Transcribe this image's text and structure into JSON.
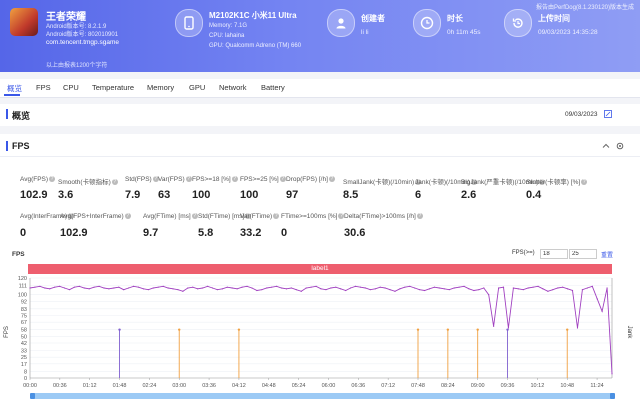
{
  "header": {
    "watermark": "报告由PerfDog(8.1.230120)版本生成",
    "app": {
      "name": "王者荣耀",
      "android_version": "Android版本号: 8.2.1.9",
      "android_build": "Android版本号: 802010901",
      "package": "com.tencent.tmgp.sgame",
      "subtitle": "以上由报表1200个字符"
    },
    "device": {
      "name": "M2102K1C 小米11 Ultra",
      "memory": "Memory: 7.1G",
      "cpu": "CPU: lahaina",
      "gpu": "GPU: Qualcomm Adreno (TM) 660"
    },
    "creator": {
      "title": "创建者",
      "value": "li li"
    },
    "duration": {
      "title": "时长",
      "value": "0h 11m 45s"
    },
    "upload": {
      "title": "上传时间",
      "value": "09/03/2023 14:35:28"
    }
  },
  "tabs": [
    "概览",
    "FPS",
    "CPU",
    "Temperature",
    "Memory",
    "GPU",
    "Network",
    "Battery"
  ],
  "overview": {
    "title": "概览",
    "date": "09/03/2023"
  },
  "fps_panel": {
    "title": "FPS",
    "stats_row1": [
      {
        "label": "Avg(FPS)",
        "value": "102.9"
      },
      {
        "label": "Smooth(卡顿指标)",
        "value": "3.6"
      },
      {
        "label": "Std(FPS)",
        "value": "7.9"
      },
      {
        "label": "Var(FPS)",
        "value": "63"
      },
      {
        "label": "FPS>=18 [%]",
        "value": "100"
      },
      {
        "label": "FPS>=25 [%]",
        "value": "100"
      },
      {
        "label": "Drop(FPS) [/h]",
        "value": "97"
      },
      {
        "label": "SmallJank(卡顿)(/10min)",
        "value": "8.5"
      },
      {
        "label": "Jank(卡顿)(/10min)",
        "value": "6"
      },
      {
        "label": "BigJank(严重卡顿)(/10min)",
        "value": "2.6"
      },
      {
        "label": "Stutter(卡顿率) [%]",
        "value": "0.4"
      }
    ],
    "stats_row2": [
      {
        "label": "Avg(InterFrame)",
        "value": "0"
      },
      {
        "label": "Avg(FPS+InterFrame)",
        "value": "102.9"
      },
      {
        "label": "Avg(FTime) [ms]",
        "value": "9.7"
      },
      {
        "label": "Std(FTime) [ms]",
        "value": "5.8"
      },
      {
        "label": "Var(FTime)",
        "value": "33.2"
      },
      {
        "label": "FTime>=100ms [%]",
        "value": "0"
      },
      {
        "label": "Delta(FTime)>100ms [/h]",
        "value": "30.6"
      }
    ],
    "chart_title": "FPS",
    "fps_threshold_label": "FPS(>=)",
    "fps_threshold_1": "18",
    "fps_threshold_2": "25",
    "reset_label": "重置",
    "label_bar": "label1"
  },
  "chart_data": {
    "type": "line",
    "ylabel": "FPS",
    "ylabel_right": "Jank",
    "ylim": [
      0,
      120
    ],
    "yticks": [
      0,
      8,
      17,
      25,
      33,
      42,
      50,
      58,
      67,
      75,
      83,
      92,
      100,
      111,
      120
    ],
    "xticks": [
      "00:00",
      "00:36",
      "01:12",
      "01:48",
      "02:24",
      "03:00",
      "03:36",
      "04:12",
      "04:48",
      "05:24",
      "06:00",
      "06:36",
      "07:12",
      "07:48",
      "08:24",
      "09:00",
      "09:36",
      "10:12",
      "10:48",
      "11:24"
    ],
    "series": [
      {
        "name": "FPS",
        "color": "#a040c0"
      }
    ],
    "fps_values": [
      108,
      109,
      110,
      108,
      107,
      109,
      110,
      108,
      106,
      109,
      110,
      108,
      107,
      109,
      110,
      108,
      107,
      108,
      109,
      106,
      108,
      110,
      109,
      107,
      106,
      108,
      109,
      110,
      108,
      107,
      106,
      104,
      108,
      109,
      107,
      108,
      110,
      108,
      106,
      107,
      109,
      108,
      107,
      109,
      110,
      108,
      105,
      106,
      108,
      109,
      110,
      108,
      107,
      108,
      106,
      104,
      108,
      109,
      110,
      107,
      106,
      108,
      109,
      107,
      105,
      108,
      110,
      109,
      108,
      106,
      107,
      109,
      108,
      106,
      104,
      107,
      109,
      110,
      108,
      106,
      105,
      107,
      109,
      108,
      107,
      106,
      108,
      109,
      110,
      107,
      105,
      106,
      108,
      100,
      62,
      108,
      109,
      60,
      108,
      107,
      106,
      108,
      109,
      110,
      107,
      104,
      106,
      108,
      109,
      107,
      105,
      60,
      106,
      108,
      110,
      95,
      80,
      108,
      5
    ],
    "jank_markers": [
      {
        "t": "01:48",
        "color": "#8060d0"
      },
      {
        "t": "03:00",
        "color": "#f0a040"
      },
      {
        "t": "04:12",
        "color": "#f0a040"
      },
      {
        "t": "07:48",
        "color": "#f0a040"
      },
      {
        "t": "08:24",
        "color": "#f0a040"
      },
      {
        "t": "09:00",
        "color": "#f0a040"
      },
      {
        "t": "09:36",
        "color": "#8060d0"
      },
      {
        "t": "10:48",
        "color": "#f0a040"
      }
    ]
  }
}
